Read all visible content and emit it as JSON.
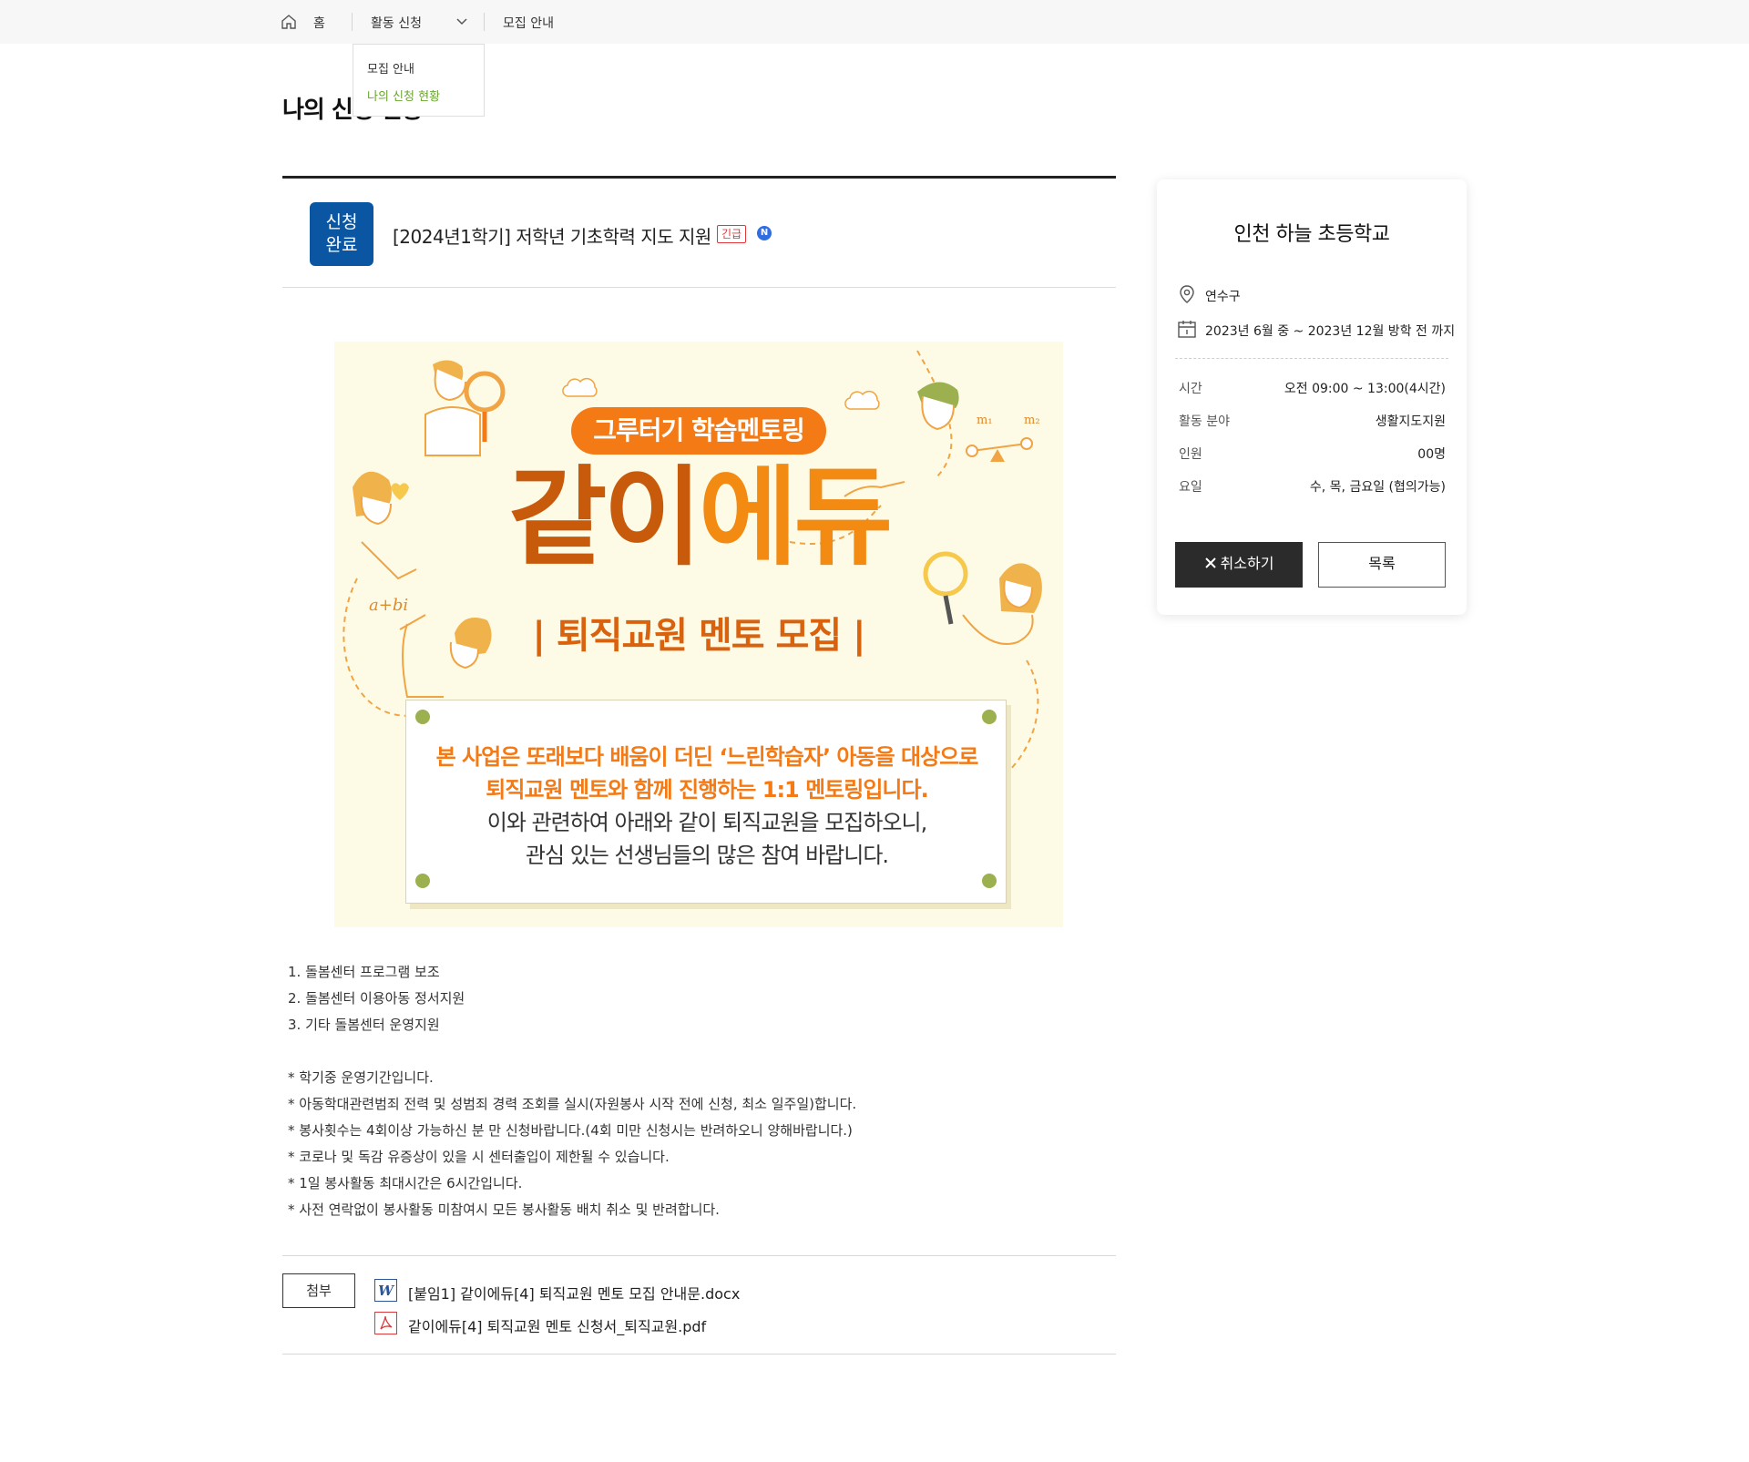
{
  "breadcrumb": {
    "home_label": "홈",
    "dropdown_label": "활동 신청",
    "current_label": "모집 안내",
    "menu_items": [
      "모집 안내",
      "나의 신청 현황"
    ]
  },
  "page": {
    "title": "나의 신청 현황"
  },
  "post": {
    "status_line1": "신청",
    "status_line2": "완료",
    "title": "[2024년1학기] 저학년 기초학력 지도 지원",
    "urgent_badge": "긴급",
    "new_badge": "N"
  },
  "poster": {
    "tagline": "그루터기 학습멘토링",
    "main_a": "같이",
    "main_b": "에듀",
    "subtitle": "| 퇴직교원 멘토 모집 |",
    "card_lines": [
      "본 사업은 또래보다 배움이 더딘 ‘느린학습자’ 아동을 대상으로",
      "퇴직교원 멘토와 함께 진행하는 1:1 멘토링입니다.",
      "이와 관련하여 아래와 같이 퇴직교원을 모집하오니,",
      "관심 있는 선생님들의 많은 참여 바랍니다."
    ],
    "math_text": "a+bi",
    "scale_m1": "m₁",
    "scale_m2": "m₂"
  },
  "body": {
    "tasks": [
      "1. 돌봄센터 프로그램 보조",
      "2. 돌봄센터 이용아동 정서지원",
      "3. 기타 돌봄센터 운영지원"
    ],
    "notes": [
      "* 학기중 운영기간입니다.",
      "* 아동학대관련범죄 전력 및 성범죄 경력 조회를 실시(자원봉사 시작 전에 신청, 최소 일주일)합니다.",
      "* 봉사횟수는 4회이상 가능하신 분 만 신청바랍니다.(4회 미만 신청시는 반려하오니 양해바랍니다.)",
      "* 코로나 및 독감 유증상이 있을 시 센터출입이 제한될 수 있습니다.",
      "* 1일 봉사활동 최대시간은 6시간입니다.",
      "* 사전 연락없이 봉사활동 미참여시 모든 봉사활동 배치 취소 및 반려합니다."
    ]
  },
  "attachments": {
    "label": "첨부",
    "files": [
      {
        "name": "[붙임1] 같이에듀[4] 퇴직교원 멘토 모집 안내문.docx",
        "icon": "word-file-icon"
      },
      {
        "name": "같이에듀[4] 퇴직교원 멘토 신청서_퇴직교원.pdf",
        "icon": "pdf-file-icon"
      }
    ]
  },
  "sidebar": {
    "school": "인천 하늘 초등학교",
    "location": "연수구",
    "period": "2023년 6월 중 ~ 2023년 12월 방학 전 까지",
    "rows": [
      {
        "label": "시간",
        "value": "오전 09:00 ~ 13:00(4시간)"
      },
      {
        "label": "활동 분야",
        "value": "생활지도지원"
      },
      {
        "label": "인원",
        "value": "00명"
      },
      {
        "label": "요일",
        "value": "수, 목, 금요일 (협의가능)"
      }
    ],
    "cancel_label": "취소하기",
    "list_label": "목록"
  },
  "colors": {
    "status_blue": "#0a56a3",
    "accent_green": "#6aa52e",
    "urgent_red": "#e0373a",
    "poster_orange": "#f47a16",
    "poster_bg": "#fdfbe6"
  }
}
